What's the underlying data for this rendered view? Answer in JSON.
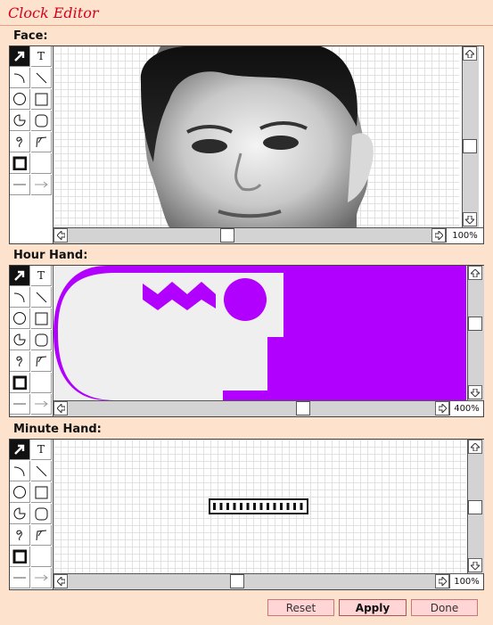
{
  "window": {
    "title": "Clock Editor"
  },
  "tools": {
    "text_tool_glyph": "T"
  },
  "sections": {
    "face": {
      "label": "Face:",
      "zoom": "100%"
    },
    "hour_hand": {
      "label": "Hour Hand:",
      "zoom": "400%"
    },
    "minute_hand": {
      "label": "Minute Hand:",
      "zoom": "100%"
    }
  },
  "buttons": {
    "reset": "Reset",
    "apply": "Apply",
    "done": "Done"
  },
  "colors": {
    "background": "#fde3cd",
    "title": "#d8001b",
    "hour_hand_fill": "#b200ff",
    "button": "#ffd5d5"
  }
}
